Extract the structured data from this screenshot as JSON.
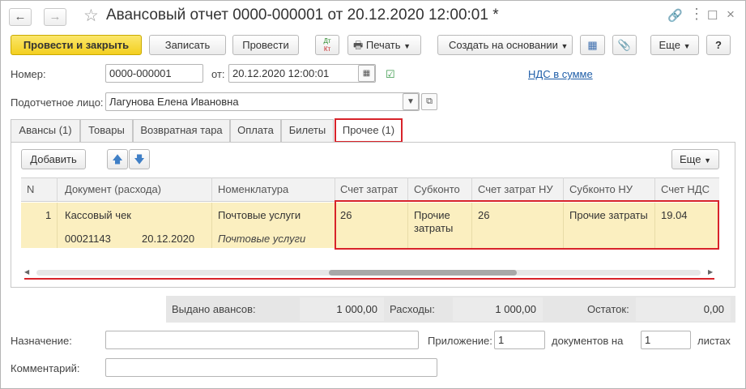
{
  "window": {
    "title": "Авансовый отчет 0000-000001 от 20.12.2020 12:00:01 *"
  },
  "toolbar": {
    "post_close": "Провести и закрыть",
    "save": "Записать",
    "post": "Провести",
    "dtkt_top": "Дт",
    "dtkt_bottom": "Кт",
    "print": "Печать",
    "create_based": "Создать на основании",
    "more": "Еще",
    "help": "?"
  },
  "form": {
    "number_label": "Номер:",
    "number_value": "0000-000001",
    "date_label": "от:",
    "date_value": "20.12.2020 12:00:01",
    "vat_link": "НДС в сумме",
    "person_label": "Подотчетное лицо:",
    "person_value": "Лагунова Елена Ивановна"
  },
  "tabs": [
    {
      "label": "Авансы (1)"
    },
    {
      "label": "Товары"
    },
    {
      "label": "Возвратная тара"
    },
    {
      "label": "Оплата"
    },
    {
      "label": "Билеты"
    },
    {
      "label": "Прочее (1)"
    }
  ],
  "panel": {
    "add_button": "Добавить",
    "more": "Еще"
  },
  "table": {
    "columns": [
      "N",
      "Документ (расхода)",
      "Номенклатура",
      "Счет затрат",
      "Субконто",
      "Счет затрат НУ",
      "Субконто НУ",
      "Счет НДС"
    ],
    "rows": [
      {
        "n": "1",
        "document": "Кассовый чек",
        "doc_number": "00021143",
        "doc_date": "20.12.2020",
        "nomenclature": "Почтовые услуги",
        "nomenclature_sub": "Почтовые услуги",
        "cost_account": "26",
        "subconto_line1": "Прочие",
        "subconto_line2": "затраты",
        "cost_account_nu": "26",
        "subconto_nu": "Прочие затраты",
        "vat_account": "19.04"
      }
    ]
  },
  "totals": {
    "advances_label": "Выдано авансов:",
    "advances_value": "1 000,00",
    "expenses_label": "Расходы:",
    "expenses_value": "1 000,00",
    "balance_label": "Остаток:",
    "balance_value": "0,00"
  },
  "footer": {
    "purpose_label": "Назначение:",
    "purpose_value": "",
    "attachment_label": "Приложение:",
    "attachment_value": "1",
    "docs_on": "документов на",
    "sheets_value": "1",
    "sheets_label": "листах",
    "comment_label": "Комментарий:",
    "comment_value": ""
  },
  "colors": {
    "primary_button": "#f5d434",
    "selected_row": "#fbefc0",
    "highlight_border": "#d8232a",
    "link": "#1f5ea8"
  }
}
